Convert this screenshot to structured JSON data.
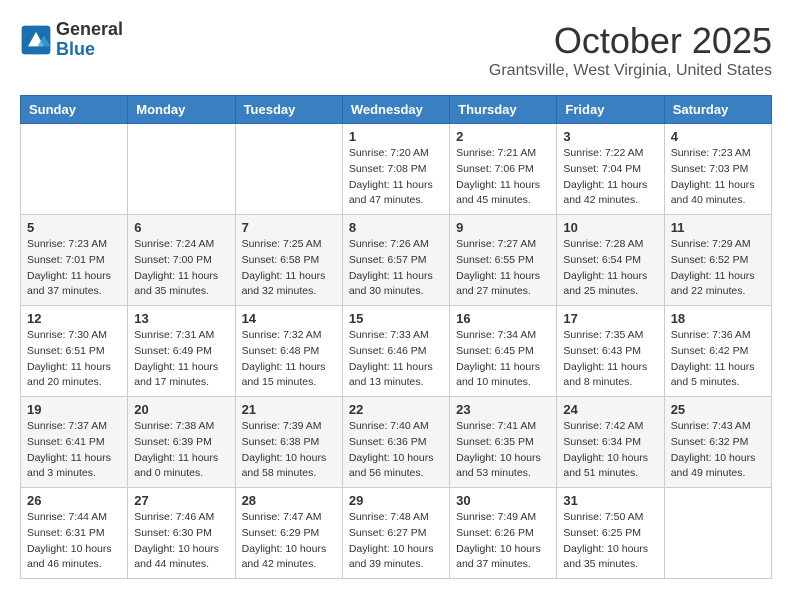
{
  "logo": {
    "general": "General",
    "blue": "Blue"
  },
  "title": "October 2025",
  "location": "Grantsville, West Virginia, United States",
  "weekdays": [
    "Sunday",
    "Monday",
    "Tuesday",
    "Wednesday",
    "Thursday",
    "Friday",
    "Saturday"
  ],
  "weeks": [
    [
      {
        "day": "",
        "info": ""
      },
      {
        "day": "",
        "info": ""
      },
      {
        "day": "",
        "info": ""
      },
      {
        "day": "1",
        "info": "Sunrise: 7:20 AM\nSunset: 7:08 PM\nDaylight: 11 hours and 47 minutes."
      },
      {
        "day": "2",
        "info": "Sunrise: 7:21 AM\nSunset: 7:06 PM\nDaylight: 11 hours and 45 minutes."
      },
      {
        "day": "3",
        "info": "Sunrise: 7:22 AM\nSunset: 7:04 PM\nDaylight: 11 hours and 42 minutes."
      },
      {
        "day": "4",
        "info": "Sunrise: 7:23 AM\nSunset: 7:03 PM\nDaylight: 11 hours and 40 minutes."
      }
    ],
    [
      {
        "day": "5",
        "info": "Sunrise: 7:23 AM\nSunset: 7:01 PM\nDaylight: 11 hours and 37 minutes."
      },
      {
        "day": "6",
        "info": "Sunrise: 7:24 AM\nSunset: 7:00 PM\nDaylight: 11 hours and 35 minutes."
      },
      {
        "day": "7",
        "info": "Sunrise: 7:25 AM\nSunset: 6:58 PM\nDaylight: 11 hours and 32 minutes."
      },
      {
        "day": "8",
        "info": "Sunrise: 7:26 AM\nSunset: 6:57 PM\nDaylight: 11 hours and 30 minutes."
      },
      {
        "day": "9",
        "info": "Sunrise: 7:27 AM\nSunset: 6:55 PM\nDaylight: 11 hours and 27 minutes."
      },
      {
        "day": "10",
        "info": "Sunrise: 7:28 AM\nSunset: 6:54 PM\nDaylight: 11 hours and 25 minutes."
      },
      {
        "day": "11",
        "info": "Sunrise: 7:29 AM\nSunset: 6:52 PM\nDaylight: 11 hours and 22 minutes."
      }
    ],
    [
      {
        "day": "12",
        "info": "Sunrise: 7:30 AM\nSunset: 6:51 PM\nDaylight: 11 hours and 20 minutes."
      },
      {
        "day": "13",
        "info": "Sunrise: 7:31 AM\nSunset: 6:49 PM\nDaylight: 11 hours and 17 minutes."
      },
      {
        "day": "14",
        "info": "Sunrise: 7:32 AM\nSunset: 6:48 PM\nDaylight: 11 hours and 15 minutes."
      },
      {
        "day": "15",
        "info": "Sunrise: 7:33 AM\nSunset: 6:46 PM\nDaylight: 11 hours and 13 minutes."
      },
      {
        "day": "16",
        "info": "Sunrise: 7:34 AM\nSunset: 6:45 PM\nDaylight: 11 hours and 10 minutes."
      },
      {
        "day": "17",
        "info": "Sunrise: 7:35 AM\nSunset: 6:43 PM\nDaylight: 11 hours and 8 minutes."
      },
      {
        "day": "18",
        "info": "Sunrise: 7:36 AM\nSunset: 6:42 PM\nDaylight: 11 hours and 5 minutes."
      }
    ],
    [
      {
        "day": "19",
        "info": "Sunrise: 7:37 AM\nSunset: 6:41 PM\nDaylight: 11 hours and 3 minutes."
      },
      {
        "day": "20",
        "info": "Sunrise: 7:38 AM\nSunset: 6:39 PM\nDaylight: 11 hours and 0 minutes."
      },
      {
        "day": "21",
        "info": "Sunrise: 7:39 AM\nSunset: 6:38 PM\nDaylight: 10 hours and 58 minutes."
      },
      {
        "day": "22",
        "info": "Sunrise: 7:40 AM\nSunset: 6:36 PM\nDaylight: 10 hours and 56 minutes."
      },
      {
        "day": "23",
        "info": "Sunrise: 7:41 AM\nSunset: 6:35 PM\nDaylight: 10 hours and 53 minutes."
      },
      {
        "day": "24",
        "info": "Sunrise: 7:42 AM\nSunset: 6:34 PM\nDaylight: 10 hours and 51 minutes."
      },
      {
        "day": "25",
        "info": "Sunrise: 7:43 AM\nSunset: 6:32 PM\nDaylight: 10 hours and 49 minutes."
      }
    ],
    [
      {
        "day": "26",
        "info": "Sunrise: 7:44 AM\nSunset: 6:31 PM\nDaylight: 10 hours and 46 minutes."
      },
      {
        "day": "27",
        "info": "Sunrise: 7:46 AM\nSunset: 6:30 PM\nDaylight: 10 hours and 44 minutes."
      },
      {
        "day": "28",
        "info": "Sunrise: 7:47 AM\nSunset: 6:29 PM\nDaylight: 10 hours and 42 minutes."
      },
      {
        "day": "29",
        "info": "Sunrise: 7:48 AM\nSunset: 6:27 PM\nDaylight: 10 hours and 39 minutes."
      },
      {
        "day": "30",
        "info": "Sunrise: 7:49 AM\nSunset: 6:26 PM\nDaylight: 10 hours and 37 minutes."
      },
      {
        "day": "31",
        "info": "Sunrise: 7:50 AM\nSunset: 6:25 PM\nDaylight: 10 hours and 35 minutes."
      },
      {
        "day": "",
        "info": ""
      }
    ]
  ]
}
